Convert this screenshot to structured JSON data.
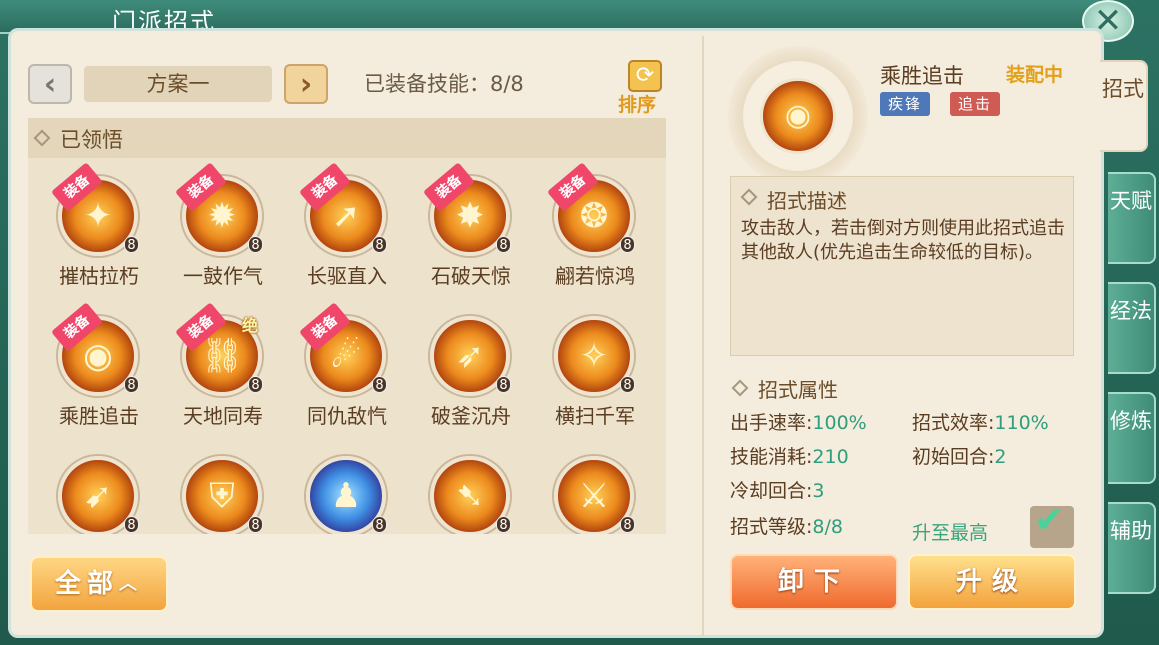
{
  "window": {
    "title": "门派招式",
    "close_label": "✕"
  },
  "plan": {
    "prev": "‹",
    "next": "›",
    "name": "方案一",
    "equipped": "已装备技能：8/8"
  },
  "sort": {
    "icon": "⟳",
    "label": "排序"
  },
  "section": {
    "label": "已领悟"
  },
  "skills": [
    {
      "name": "摧枯拉朽",
      "level": "8",
      "equip": "装备",
      "glyph": "✦",
      "jue": ""
    },
    {
      "name": "一鼓作气",
      "level": "8",
      "equip": "装备",
      "glyph": "✹",
      "jue": ""
    },
    {
      "name": "长驱直入",
      "level": "8",
      "equip": "装备",
      "glyph": "➚",
      "jue": ""
    },
    {
      "name": "石破天惊",
      "level": "8",
      "equip": "装备",
      "glyph": "✸",
      "jue": ""
    },
    {
      "name": "翩若惊鸿",
      "level": "8",
      "equip": "装备",
      "glyph": "❂",
      "jue": ""
    },
    {
      "name": "乘胜追击",
      "level": "8",
      "equip": "装备",
      "glyph": "◉",
      "jue": ""
    },
    {
      "name": "天地同寿",
      "level": "8",
      "equip": "装备",
      "glyph": "⛓",
      "jue": "绝"
    },
    {
      "name": "同仇敌忾",
      "level": "8",
      "equip": "装备",
      "glyph": "☄",
      "jue": ""
    },
    {
      "name": "破釜沉舟",
      "level": "8",
      "equip": "",
      "glyph": "➶",
      "jue": ""
    },
    {
      "name": "横扫千军",
      "level": "8",
      "equip": "",
      "glyph": "✧",
      "jue": ""
    },
    {
      "name": "",
      "level": "8",
      "equip": "",
      "glyph": "➹",
      "jue": ""
    },
    {
      "name": "",
      "level": "8",
      "equip": "",
      "glyph": "⛨",
      "jue": ""
    },
    {
      "name": "",
      "level": "8",
      "equip": "",
      "glyph": "♟",
      "jue": ""
    },
    {
      "name": "",
      "level": "8",
      "equip": "",
      "glyph": "➷",
      "jue": ""
    },
    {
      "name": "",
      "level": "8",
      "equip": "",
      "glyph": "⚔",
      "jue": ""
    }
  ],
  "all_button": {
    "label": "全部",
    "icon": "chevron-up-icon"
  },
  "detail": {
    "name": "乘胜追击",
    "status": "装配中",
    "tags": [
      "疾锋",
      "追击"
    ],
    "glyph": "◉",
    "desc_title": "招式描述",
    "desc_text": "攻击敌人，若击倒对方则使用此招式追击其他敌人(优先追击生命较低的目标)。",
    "attr_title": "招式属性",
    "attrs": {
      "speed_label": "出手速率:",
      "speed": "100%",
      "eff_label": "招式效率:",
      "eff": "110%",
      "cost_label": "技能消耗:",
      "cost": "210",
      "init_label": "初始回合:",
      "init": "2",
      "cd_label": "冷却回合:",
      "cd": "3",
      "lvl_label": "招式等级:",
      "lvl": "8/8"
    },
    "upgrade_max": "升至最高",
    "unequip": "卸下",
    "upgrade": "升级"
  },
  "side_tabs": [
    "招式",
    "天赋",
    "经法",
    "修炼",
    "辅助"
  ]
}
